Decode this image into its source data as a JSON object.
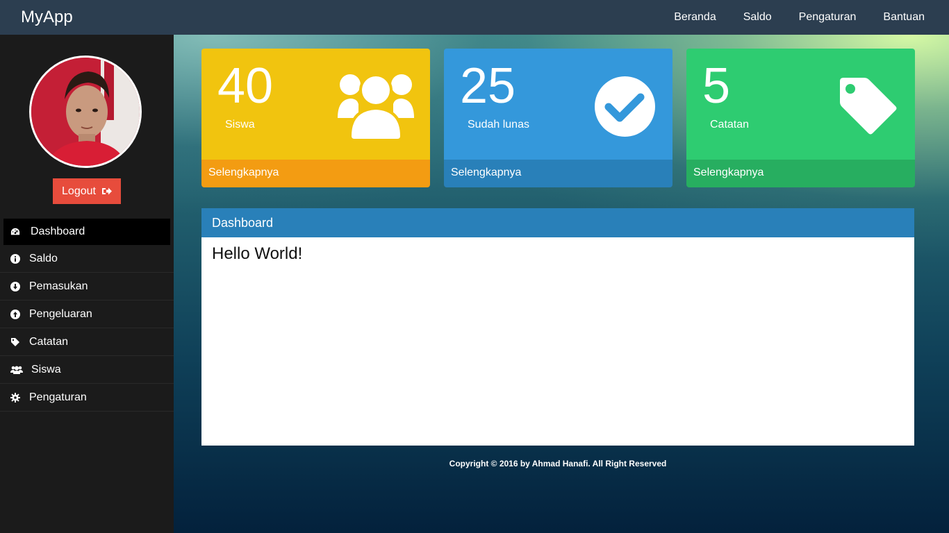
{
  "app": {
    "brand": "MyApp"
  },
  "navbar": {
    "links": [
      {
        "label": "Beranda"
      },
      {
        "label": "Saldo"
      },
      {
        "label": "Pengaturan"
      },
      {
        "label": "Bantuan"
      }
    ]
  },
  "sidebar": {
    "logout_label": "Logout",
    "logout_icon": "sign-out-icon",
    "items": [
      {
        "label": "Dashboard",
        "icon": "dashboard-gauge-icon",
        "active": true
      },
      {
        "label": "Saldo",
        "icon": "info-circle-icon"
      },
      {
        "label": "Pemasukan",
        "icon": "arrow-circle-down-icon"
      },
      {
        "label": "Pengeluaran",
        "icon": "arrow-circle-up-icon"
      },
      {
        "label": "Catatan",
        "icon": "tag-icon"
      },
      {
        "label": "Siswa",
        "icon": "users-icon"
      },
      {
        "label": "Pengaturan",
        "icon": "gear-icon"
      }
    ]
  },
  "cards": [
    {
      "value": "40",
      "label": "Siswa",
      "footer": "Selengkapnya",
      "icon": "users-icon",
      "color": "#f1c40f",
      "footer_color": "#f39c12"
    },
    {
      "value": "25",
      "label": "Sudah lunas",
      "footer": "Selengkapnya",
      "icon": "check-circle-icon",
      "color": "#3498db",
      "footer_color": "#2980b9"
    },
    {
      "value": "5",
      "label": "Catatan",
      "footer": "Selengkapnya",
      "icon": "tag-icon",
      "color": "#2ecc71",
      "footer_color": "#27ae60"
    }
  ],
  "panel": {
    "title": "Dashboard",
    "content": "Hello World!"
  },
  "footer": {
    "text": "Copyright © 2016 by Ahmad Hanafi. All Right Reserved"
  },
  "colors": {
    "navbar": "#2c3e50",
    "sidebar": "#1b1b1b",
    "logout": "#e74c3c",
    "panel_header": "#2980b9"
  }
}
